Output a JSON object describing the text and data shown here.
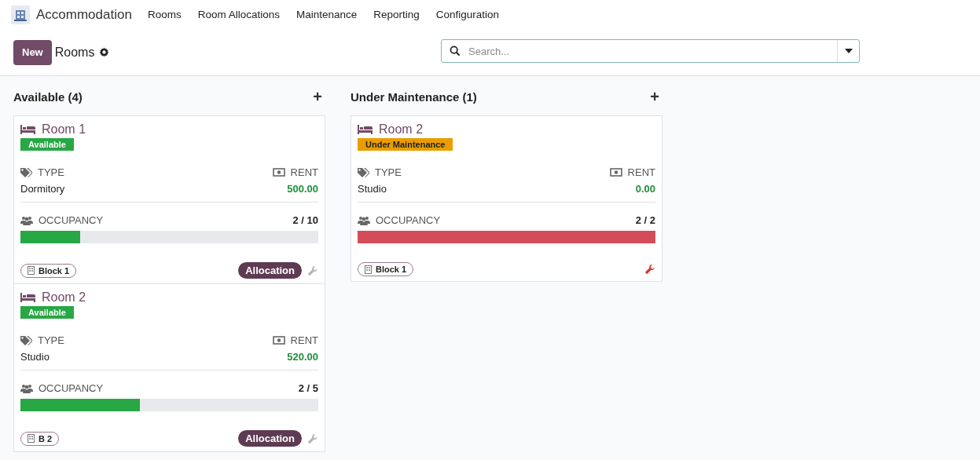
{
  "app": {
    "title": "Accommodation"
  },
  "menu": [
    "Rooms",
    "Room Allocations",
    "Maintenance",
    "Reporting",
    "Configuration"
  ],
  "control_bar": {
    "new_button": "New",
    "breadcrumb": "Rooms",
    "search": {
      "placeholder": "Search..."
    }
  },
  "columns": [
    {
      "title": "Available (4)",
      "add": "+",
      "cards": [
        {
          "name": "Room 1",
          "status": {
            "label": "Available",
            "kind": "available"
          },
          "type_label": "TYPE",
          "type": "Dormitory",
          "rent_label": "RENT",
          "rent": "500.00",
          "occupancy_label": "OCCUPANCY",
          "occupancy": "2 / 10",
          "level": 0.2,
          "block": "Block 1",
          "action": "Allocation",
          "wrench_active": false
        },
        {
          "name": "Room 2",
          "status": {
            "label": "Available",
            "kind": "available"
          },
          "type_label": "TYPE",
          "type": "Studio",
          "rent_label": "RENT",
          "rent": "520.00",
          "occupancy_label": "OCCUPANCY",
          "occupancy": "2 / 5",
          "level": 0.4,
          "block": "B 2",
          "action": "Allocation",
          "wrench_active": false
        }
      ]
    },
    {
      "title": "Under Maintenance (1)",
      "add": "+",
      "cards": [
        {
          "name": "Room 2",
          "status": {
            "label": "Under Maintenance",
            "kind": "maintenance"
          },
          "type_label": "TYPE",
          "type": "Studio",
          "rent_label": "RENT",
          "rent": "0.00",
          "occupancy_label": "OCCUPANCY",
          "occupancy": "2 / 2",
          "level": 1,
          "block": "Block 1",
          "wrench_active": true
        }
      ]
    }
  ]
}
